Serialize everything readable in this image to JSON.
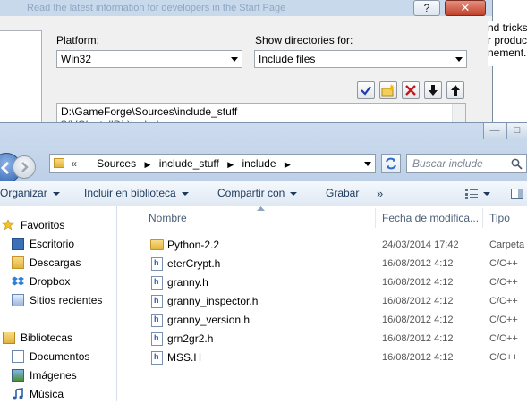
{
  "vs_dialog": {
    "title_partial": "Read the latest information for developers in the Start Page",
    "help_glyph": "?",
    "close_glyph": "✕",
    "platform_label": "Platform:",
    "platform_value": "Win32",
    "show_dirs_label": "Show directories for:",
    "show_dirs_value": "Include files",
    "toolbar": [
      "check-icon",
      "new-folder-icon",
      "delete-icon",
      "move-down-icon",
      "move-up-icon"
    ],
    "path_line_1": "D:\\GameForge\\Sources\\include_stuff",
    "path_line_2": "$(VCInstallDir)include",
    "right_text_lines": [
      "nd tricks",
      "r product",
      "nement."
    ]
  },
  "explorer": {
    "caption_buttons": {
      "minimize": "—",
      "maximize": "□"
    },
    "address": {
      "overflow": "«",
      "crumbs": [
        "Sources",
        "include_stuff",
        "include"
      ]
    },
    "search_placeholder": "Buscar include",
    "commands": {
      "organize": "Organizar",
      "include_library": "Incluir en biblioteca",
      "share_with": "Compartir con",
      "burn": "Grabar",
      "more": "»"
    },
    "nav": {
      "favorites_header": "Favoritos",
      "favorites": [
        "Escritorio",
        "Descargas",
        "Dropbox",
        "Sitios recientes"
      ],
      "libraries_header": "Bibliotecas",
      "libraries": [
        "Documentos",
        "Imágenes",
        "Música"
      ]
    },
    "columns": {
      "name": "Nombre",
      "date": "Fecha de modifica...",
      "type": "Tipo"
    },
    "files": [
      {
        "name": "Python-2.2",
        "date": "24/03/2014 17:42",
        "type": "Carpeta",
        "icon": "folder-icon"
      },
      {
        "name": "eterCrypt.h",
        "date": "16/08/2012 4:12",
        "type": "C/C++",
        "icon": "header-file-icon"
      },
      {
        "name": "granny.h",
        "date": "16/08/2012 4:12",
        "type": "C/C++",
        "icon": "header-file-icon"
      },
      {
        "name": "granny_inspector.h",
        "date": "16/08/2012 4:12",
        "type": "C/C++",
        "icon": "header-file-icon"
      },
      {
        "name": "granny_version.h",
        "date": "16/08/2012 4:12",
        "type": "C/C++",
        "icon": "header-file-icon"
      },
      {
        "name": "grn2gr2.h",
        "date": "16/08/2012 4:12",
        "type": "C/C++",
        "icon": "header-file-icon"
      },
      {
        "name": "MSS.H",
        "date": "16/08/2012 4:12",
        "type": "C/C++",
        "icon": "header-file-icon"
      }
    ]
  }
}
